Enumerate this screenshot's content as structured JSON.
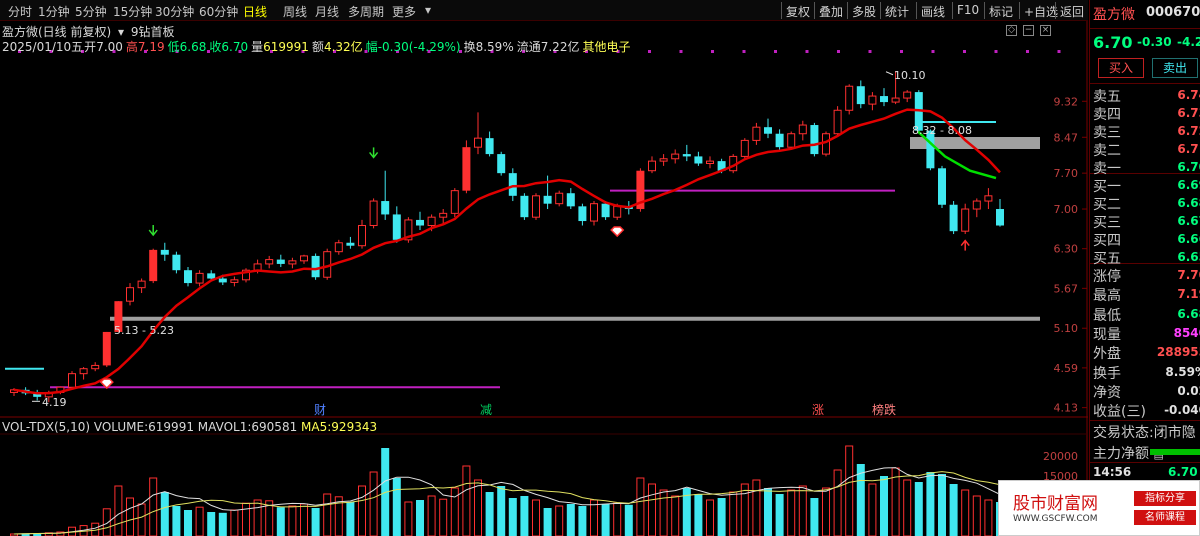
{
  "toolbar": {
    "left_items": [
      "分时",
      "1分钟",
      "5分钟",
      "15分钟",
      "30分钟",
      "60分钟",
      "日线",
      "周线",
      "月线",
      "多周期",
      "更多"
    ],
    "active_item": "日线",
    "right_items": [
      "复权",
      "叠加",
      "多股",
      "统计",
      "画线",
      "F10",
      "标记",
      "+自选",
      "返回"
    ]
  },
  "header": {
    "title": "盈方微(日线 前复权)",
    "indicator_name": "9钻首板",
    "date": "2025/01/10五",
    "open_label": "开",
    "open": "7.00",
    "high_label": "高",
    "high": "7.19",
    "low_label": "低",
    "low": "6.68",
    "close_label": "收",
    "close": "6.70",
    "volume_label": "量",
    "volume": "619991",
    "amount_label": "额",
    "amount": "4.32亿",
    "change_label": "幅",
    "change": "-0.30(-4.29%)",
    "turnover_label": "换",
    "turnover": "8.59%",
    "float_label": "流通",
    "float": "7.22亿",
    "sector": "其他电子"
  },
  "price_axis": [
    "9.32",
    "8.47",
    "7.70",
    "7.00",
    "6.30",
    "5.67",
    "5.10",
    "4.59",
    "4.13"
  ],
  "annotations": {
    "high_marker": "10.10",
    "low_marker": "4.19",
    "range_left": "5.13 - 5.23",
    "range_right": "8.32 - 8.08"
  },
  "event_markers": [
    {
      "label": "财",
      "color": "#5080ff"
    },
    {
      "label": "减",
      "color": "#00d060"
    },
    {
      "label": "涨",
      "color": "#ff5050"
    },
    {
      "label": "榜跌",
      "color": "#ff8080"
    }
  ],
  "volume_header": {
    "name": "VOL-TDX(5,10)",
    "volume_label": "VOLUME:",
    "volume": "619991",
    "mavol1_label": "MAVOL1:",
    "mavol1": "690581",
    "ma5_label": "MA5:",
    "ma5": "929343"
  },
  "volume_axis": [
    "20000",
    "15000",
    "10000"
  ],
  "right_panel": {
    "stock_name": "盈方微",
    "stock_code": "000670",
    "price": "6.70",
    "change": "-0.30",
    "change_pct": "-4.2",
    "buy_button": "买入",
    "sell_button": "卖出",
    "asks": [
      {
        "label": "卖五",
        "price": "6.74"
      },
      {
        "label": "卖四",
        "price": "6.73"
      },
      {
        "label": "卖三",
        "price": "6.72"
      },
      {
        "label": "卖二",
        "price": "6.71"
      },
      {
        "label": "卖一",
        "price": "6.70"
      }
    ],
    "bids": [
      {
        "label": "买一",
        "price": "6.69"
      },
      {
        "label": "买二",
        "price": "6.68"
      },
      {
        "label": "买三",
        "price": "6.67"
      },
      {
        "label": "买四",
        "price": "6.66"
      },
      {
        "label": "买五",
        "price": "6.65"
      }
    ],
    "stats": [
      {
        "label": "涨停",
        "value": "7.70",
        "color": "#ff5050"
      },
      {
        "label": "最高",
        "value": "7.19",
        "color": "#ff5050"
      },
      {
        "label": "最低",
        "value": "6.68",
        "color": "#00ff7f"
      },
      {
        "label": "现量",
        "value": "8540",
        "color": "#ff40ff"
      },
      {
        "label": "外盘",
        "value": "288955",
        "color": "#ff5050"
      },
      {
        "label": "换手",
        "value": "8.59%",
        "color": "#e0e0e0"
      },
      {
        "label": "净资",
        "value": "0.02",
        "color": "#e0e0e0"
      },
      {
        "label": "收益(三)",
        "value": "-0.040",
        "color": "#e0e0e0"
      }
    ],
    "trade_status_label": "交易状态:",
    "trade_status": "闭市隐",
    "main_flow_label": "主力净额",
    "last_time": "14:56",
    "last_price": "6.70"
  },
  "ad": {
    "logo": "股市财富网",
    "url": "WWW.GSCFW.COM",
    "btn1": "指标分享",
    "btn2": "名师课程"
  },
  "colors": {
    "up": "#ff3030",
    "down": "#40e8f0",
    "ma": "#e00000",
    "purple": "#c020c0",
    "grey_band": "#a0a0a0",
    "green_line": "#00e000"
  },
  "chart_data": {
    "type": "candlestick",
    "candles": [
      [
        4.3,
        4.35,
        4.26,
        4.33
      ],
      [
        4.33,
        4.36,
        4.27,
        4.29
      ],
      [
        4.29,
        4.33,
        4.21,
        4.25
      ],
      [
        4.25,
        4.32,
        4.19,
        4.3
      ],
      [
        4.3,
        4.37,
        4.28,
        4.36
      ],
      [
        4.36,
        4.55,
        4.34,
        4.52
      ],
      [
        4.52,
        4.6,
        4.45,
        4.58
      ],
      [
        4.58,
        4.66,
        4.55,
        4.62
      ],
      [
        4.62,
        5.05,
        4.6,
        5.05
      ],
      [
        5.05,
        5.48,
        5.05,
        5.48
      ],
      [
        5.48,
        5.75,
        5.42,
        5.68
      ],
      [
        5.68,
        5.82,
        5.6,
        5.78
      ],
      [
        5.78,
        6.3,
        5.75,
        6.28
      ],
      [
        6.28,
        6.4,
        6.1,
        6.2
      ],
      [
        6.2,
        6.25,
        5.9,
        5.95
      ],
      [
        5.95,
        6.0,
        5.7,
        5.75
      ],
      [
        5.75,
        5.95,
        5.7,
        5.9
      ],
      [
        5.9,
        5.95,
        5.78,
        5.82
      ],
      [
        5.82,
        5.88,
        5.72,
        5.76
      ],
      [
        5.76,
        5.85,
        5.7,
        5.8
      ],
      [
        5.8,
        5.98,
        5.76,
        5.95
      ],
      [
        5.95,
        6.12,
        5.9,
        6.05
      ],
      [
        6.05,
        6.18,
        5.98,
        6.12
      ],
      [
        6.12,
        6.2,
        6.0,
        6.05
      ],
      [
        6.05,
        6.15,
        5.98,
        6.1
      ],
      [
        6.1,
        6.2,
        6.05,
        6.18
      ],
      [
        6.18,
        6.22,
        5.8,
        5.84
      ],
      [
        5.84,
        6.3,
        5.8,
        6.25
      ],
      [
        6.25,
        6.45,
        6.2,
        6.4
      ],
      [
        6.4,
        6.5,
        6.3,
        6.35
      ],
      [
        6.35,
        6.8,
        6.3,
        6.7
      ],
      [
        6.7,
        7.2,
        6.65,
        7.15
      ],
      [
        7.15,
        7.75,
        6.8,
        6.9
      ],
      [
        6.9,
        7.05,
        6.4,
        6.45
      ],
      [
        6.45,
        6.85,
        6.4,
        6.8
      ],
      [
        6.8,
        6.95,
        6.62,
        6.7
      ],
      [
        6.7,
        6.9,
        6.6,
        6.85
      ],
      [
        6.85,
        7.0,
        6.7,
        6.92
      ],
      [
        6.92,
        7.4,
        6.85,
        7.35
      ],
      [
        7.35,
        8.4,
        7.3,
        8.25
      ],
      [
        8.25,
        9.05,
        8.1,
        8.45
      ],
      [
        8.45,
        8.6,
        8.05,
        8.1
      ],
      [
        8.1,
        8.15,
        7.65,
        7.7
      ],
      [
        7.7,
        7.8,
        7.15,
        7.25
      ],
      [
        7.25,
        7.3,
        6.8,
        6.85
      ],
      [
        6.85,
        7.3,
        6.8,
        7.25
      ],
      [
        7.25,
        7.65,
        7.0,
        7.1
      ],
      [
        7.1,
        7.35,
        7.05,
        7.3
      ],
      [
        7.3,
        7.4,
        7.0,
        7.05
      ],
      [
        7.05,
        7.1,
        6.7,
        6.78
      ],
      [
        6.78,
        7.15,
        6.7,
        7.1
      ],
      [
        7.1,
        7.15,
        6.8,
        6.85
      ],
      [
        6.85,
        7.1,
        6.8,
        7.05
      ],
      [
        7.05,
        7.15,
        6.9,
        7.0
      ],
      [
        7.0,
        7.8,
        6.95,
        7.75
      ],
      [
        7.75,
        8.05,
        7.7,
        7.95
      ],
      [
        7.95,
        8.1,
        7.85,
        8.0
      ],
      [
        8.0,
        8.2,
        7.9,
        8.1
      ],
      [
        8.1,
        8.3,
        7.95,
        8.05
      ],
      [
        8.05,
        8.15,
        7.85,
        7.9
      ],
      [
        7.9,
        8.05,
        7.8,
        7.95
      ],
      [
        7.95,
        8.0,
        7.7,
        7.75
      ],
      [
        7.75,
        8.1,
        7.7,
        8.05
      ],
      [
        8.05,
        8.45,
        8.0,
        8.4
      ],
      [
        8.4,
        8.8,
        8.3,
        8.7
      ],
      [
        8.7,
        8.9,
        8.45,
        8.55
      ],
      [
        8.55,
        8.65,
        8.2,
        8.25
      ],
      [
        8.25,
        8.6,
        8.2,
        8.55
      ],
      [
        8.55,
        8.85,
        8.4,
        8.75
      ],
      [
        8.75,
        8.8,
        8.05,
        8.1
      ],
      [
        8.1,
        8.6,
        8.05,
        8.55
      ],
      [
        8.55,
        9.2,
        8.5,
        9.1
      ],
      [
        9.1,
        9.75,
        9.0,
        9.7
      ],
      [
        9.7,
        9.85,
        9.15,
        9.25
      ],
      [
        9.25,
        9.55,
        9.1,
        9.45
      ],
      [
        9.45,
        9.65,
        9.2,
        9.3
      ],
      [
        9.3,
        10.1,
        9.25,
        9.4
      ],
      [
        9.4,
        9.6,
        9.3,
        9.55
      ],
      [
        9.55,
        9.6,
        8.6,
        8.62
      ],
      [
        8.62,
        8.65,
        7.76,
        7.8
      ],
      [
        7.8,
        7.85,
        7.02,
        7.08
      ],
      [
        7.08,
        7.15,
        6.55,
        6.6
      ],
      [
        6.6,
        7.1,
        6.55,
        7.0
      ],
      [
        7.0,
        7.2,
        6.85,
        7.15
      ],
      [
        7.15,
        7.4,
        7.0,
        7.25
      ],
      [
        7.0,
        7.19,
        6.68,
        6.7
      ]
    ],
    "volumes": [
      500,
      650,
      700,
      800,
      1000,
      2200,
      2600,
      3200,
      6800,
      12500,
      9500,
      8000,
      14500,
      11000,
      7500,
      6500,
      7200,
      6000,
      5800,
      6500,
      8200,
      9000,
      8800,
      7200,
      7500,
      8000,
      7000,
      10500,
      9800,
      8500,
      12500,
      16000,
      22000,
      14500,
      8500,
      9000,
      10000,
      9200,
      12000,
      17500,
      14000,
      11000,
      12500,
      9500,
      10000,
      9000,
      7000,
      7500,
      8000,
      7500,
      9000,
      8000,
      8200,
      7800,
      14500,
      13000,
      11500,
      10000,
      12000,
      10500,
      9000,
      9500,
      11000,
      13000,
      14000,
      12000,
      10500,
      11500,
      12500,
      9500,
      12000,
      16500,
      22500,
      18000,
      13000,
      15000,
      17000,
      14000,
      13500,
      16000,
      15500,
      13000,
      11500,
      10000,
      9000,
      8500
    ],
    "ma_line": "MA",
    "price_ylim": [
      4.05,
      10.4
    ],
    "volume_ylim": [
      0,
      24000
    ]
  }
}
